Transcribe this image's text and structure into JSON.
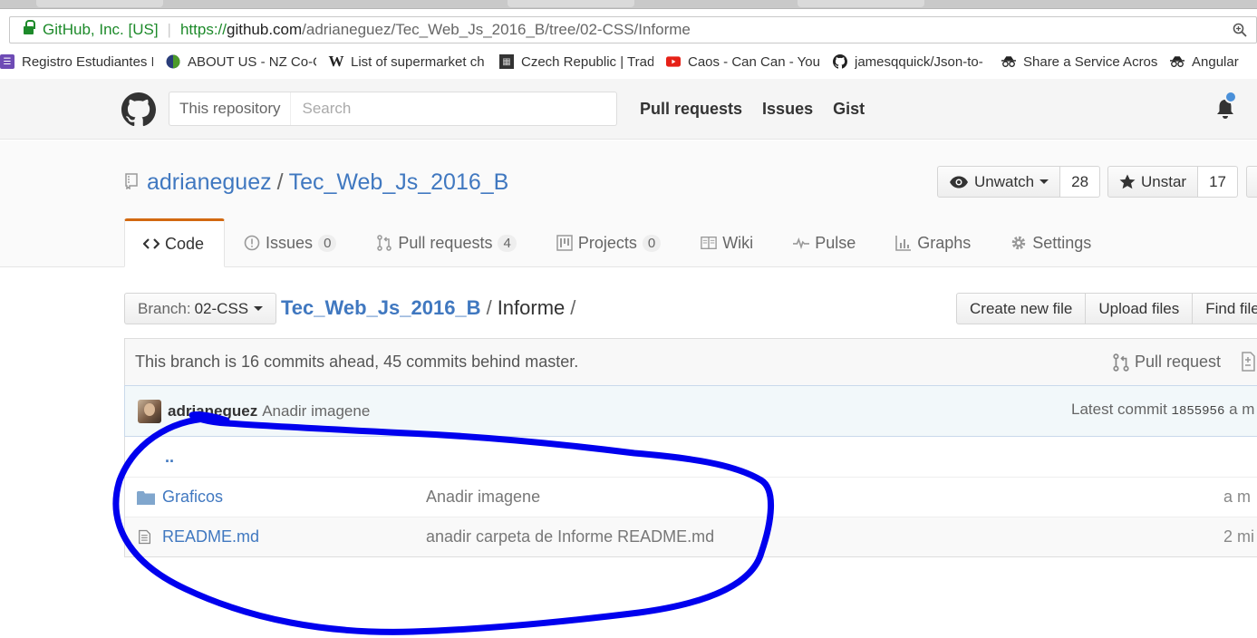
{
  "browser": {
    "secure_label": "GitHub, Inc. [US]",
    "url_scheme": "https://",
    "url_host": "github.com",
    "url_path": "/adrianeguez/Tec_Web_Js_2016_B/tree/02-CSS/Informe",
    "bookmarks": [
      {
        "label": "Registro Estudiantes F",
        "icon": "list-icon"
      },
      {
        "label": "ABOUT US - NZ Co-O",
        "icon": "globe-icon"
      },
      {
        "label": "List of supermarket ch",
        "icon": "wikipedia-icon"
      },
      {
        "label": "Czech Republic | Trade",
        "icon": "map-icon"
      },
      {
        "label": "Caos - Can Can - YouT",
        "icon": "youtube-icon"
      },
      {
        "label": "jamesqquick/Json-to-",
        "icon": "github-icon"
      },
      {
        "label": "Share a Service Across",
        "icon": "incognito-icon"
      },
      {
        "label": "Angular",
        "icon": "incognito-icon"
      }
    ]
  },
  "header": {
    "search_scope": "This repository",
    "search_placeholder": "Search",
    "nav": [
      "Pull requests",
      "Issues",
      "Gist"
    ]
  },
  "repo": {
    "owner": "adrianeguez",
    "separator": "/",
    "name": "Tec_Web_Js_2016_B",
    "watch_label": "Unwatch",
    "watch_count": "28",
    "star_label": "Unstar",
    "star_count": "17",
    "tabs": [
      {
        "label": "Code",
        "count": null
      },
      {
        "label": "Issues",
        "count": "0"
      },
      {
        "label": "Pull requests",
        "count": "4"
      },
      {
        "label": "Projects",
        "count": "0"
      },
      {
        "label": "Wiki",
        "count": null
      },
      {
        "label": "Pulse",
        "count": null
      },
      {
        "label": "Graphs",
        "count": null
      },
      {
        "label": "Settings",
        "count": null
      }
    ]
  },
  "filenav": {
    "branch_prefix": "Branch:",
    "branch_name": "02-CSS",
    "path_root": "Tec_Web_Js_2016_B",
    "path_sep": "/",
    "path_dir": "Informe",
    "path_trailing": "/",
    "buttons": [
      "Create new file",
      "Upload files",
      "Find file"
    ]
  },
  "branch_info": {
    "text": "This branch is 16 commits ahead, 45 commits behind master.",
    "pull_request_label": "Pull request"
  },
  "commit": {
    "author": "adrianeguez",
    "message": "Anadir imagene",
    "latest_label": "Latest commit",
    "sha": "1855956",
    "age": "a m"
  },
  "files": {
    "up_label": "..",
    "rows": [
      {
        "type": "folder",
        "name": "Graficos",
        "message": "Anadir imagene",
        "age": "a m"
      },
      {
        "type": "file",
        "name": "README.md",
        "message": "anadir carpeta de Informe README.md",
        "age": "2 mi"
      }
    ]
  },
  "colors": {
    "link": "#4078c0",
    "annotation": "#0000ee",
    "tab_accent": "#d26911"
  }
}
